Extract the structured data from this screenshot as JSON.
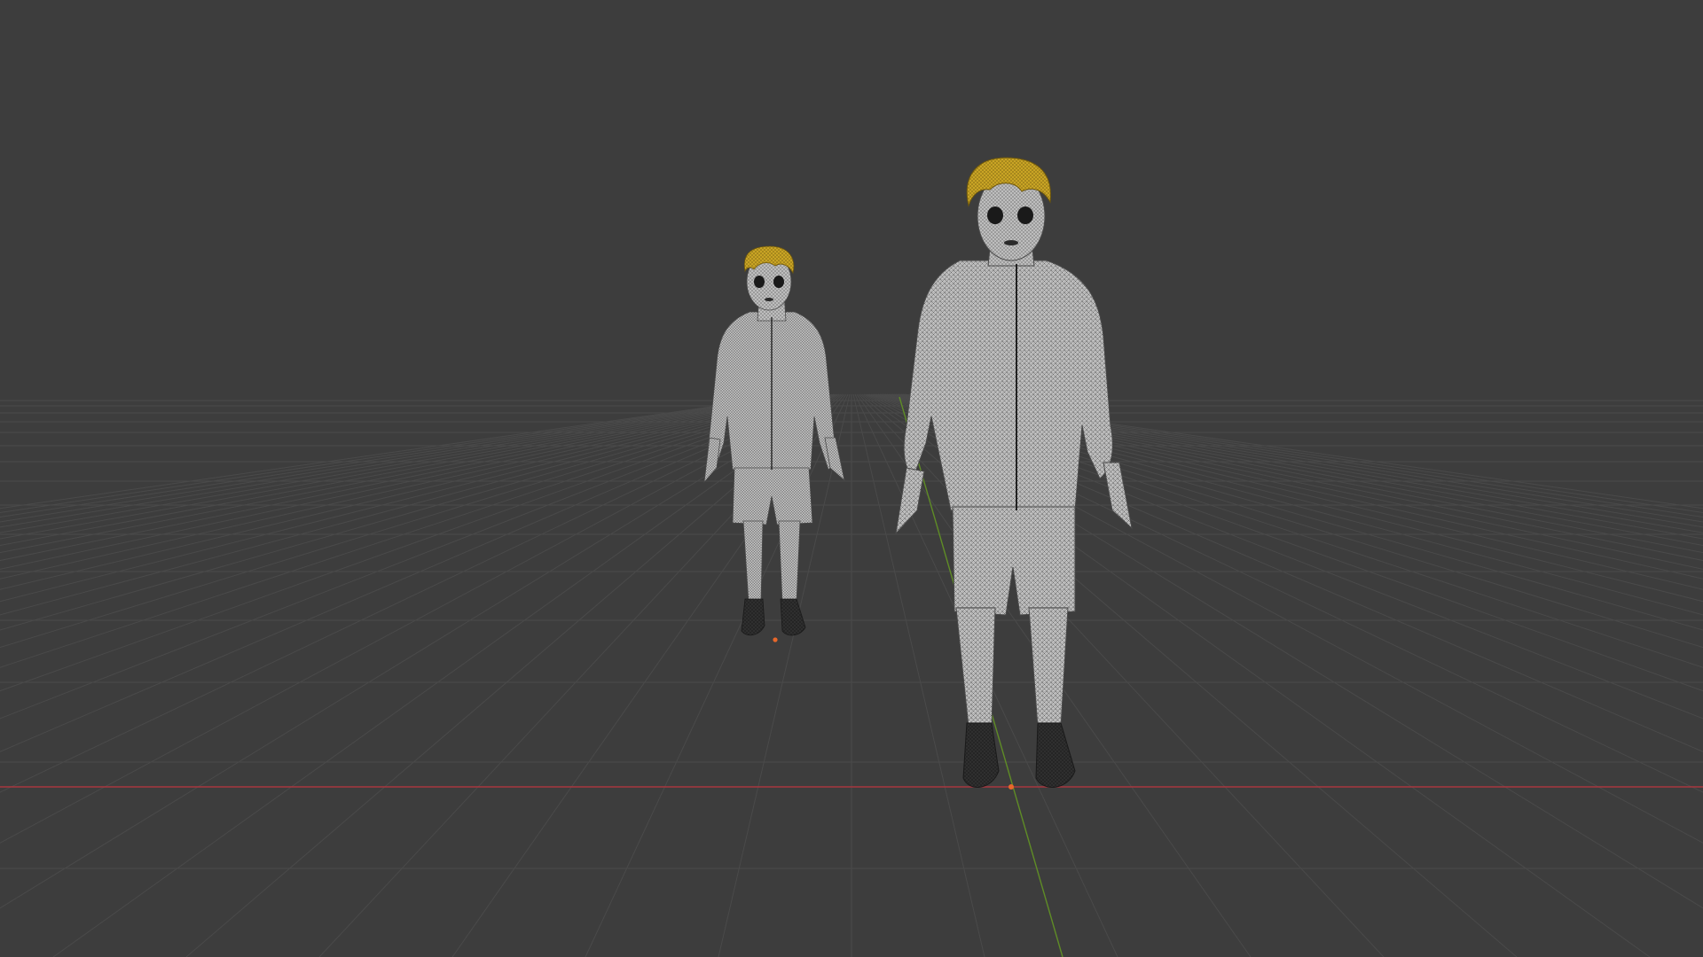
{
  "viewport": {
    "background_color": "#3d3d3d",
    "grid_color": "#4a4a4a",
    "x_axis_color": "#b83c45",
    "y_axis_color": "#6f9a2c",
    "origin_marker_color": "#e8672a"
  },
  "scene": {
    "objects": [
      {
        "name": "character-near",
        "display": "wireframe-solid",
        "hair_color": "#c9a425",
        "body_color": "#b9b9b9",
        "shoe_color": "#2e2e2e"
      },
      {
        "name": "character-far",
        "display": "wireframe-solid",
        "hair_color": "#c9a425",
        "body_color": "#b9b9b9",
        "shoe_color": "#2e2e2e"
      }
    ]
  }
}
